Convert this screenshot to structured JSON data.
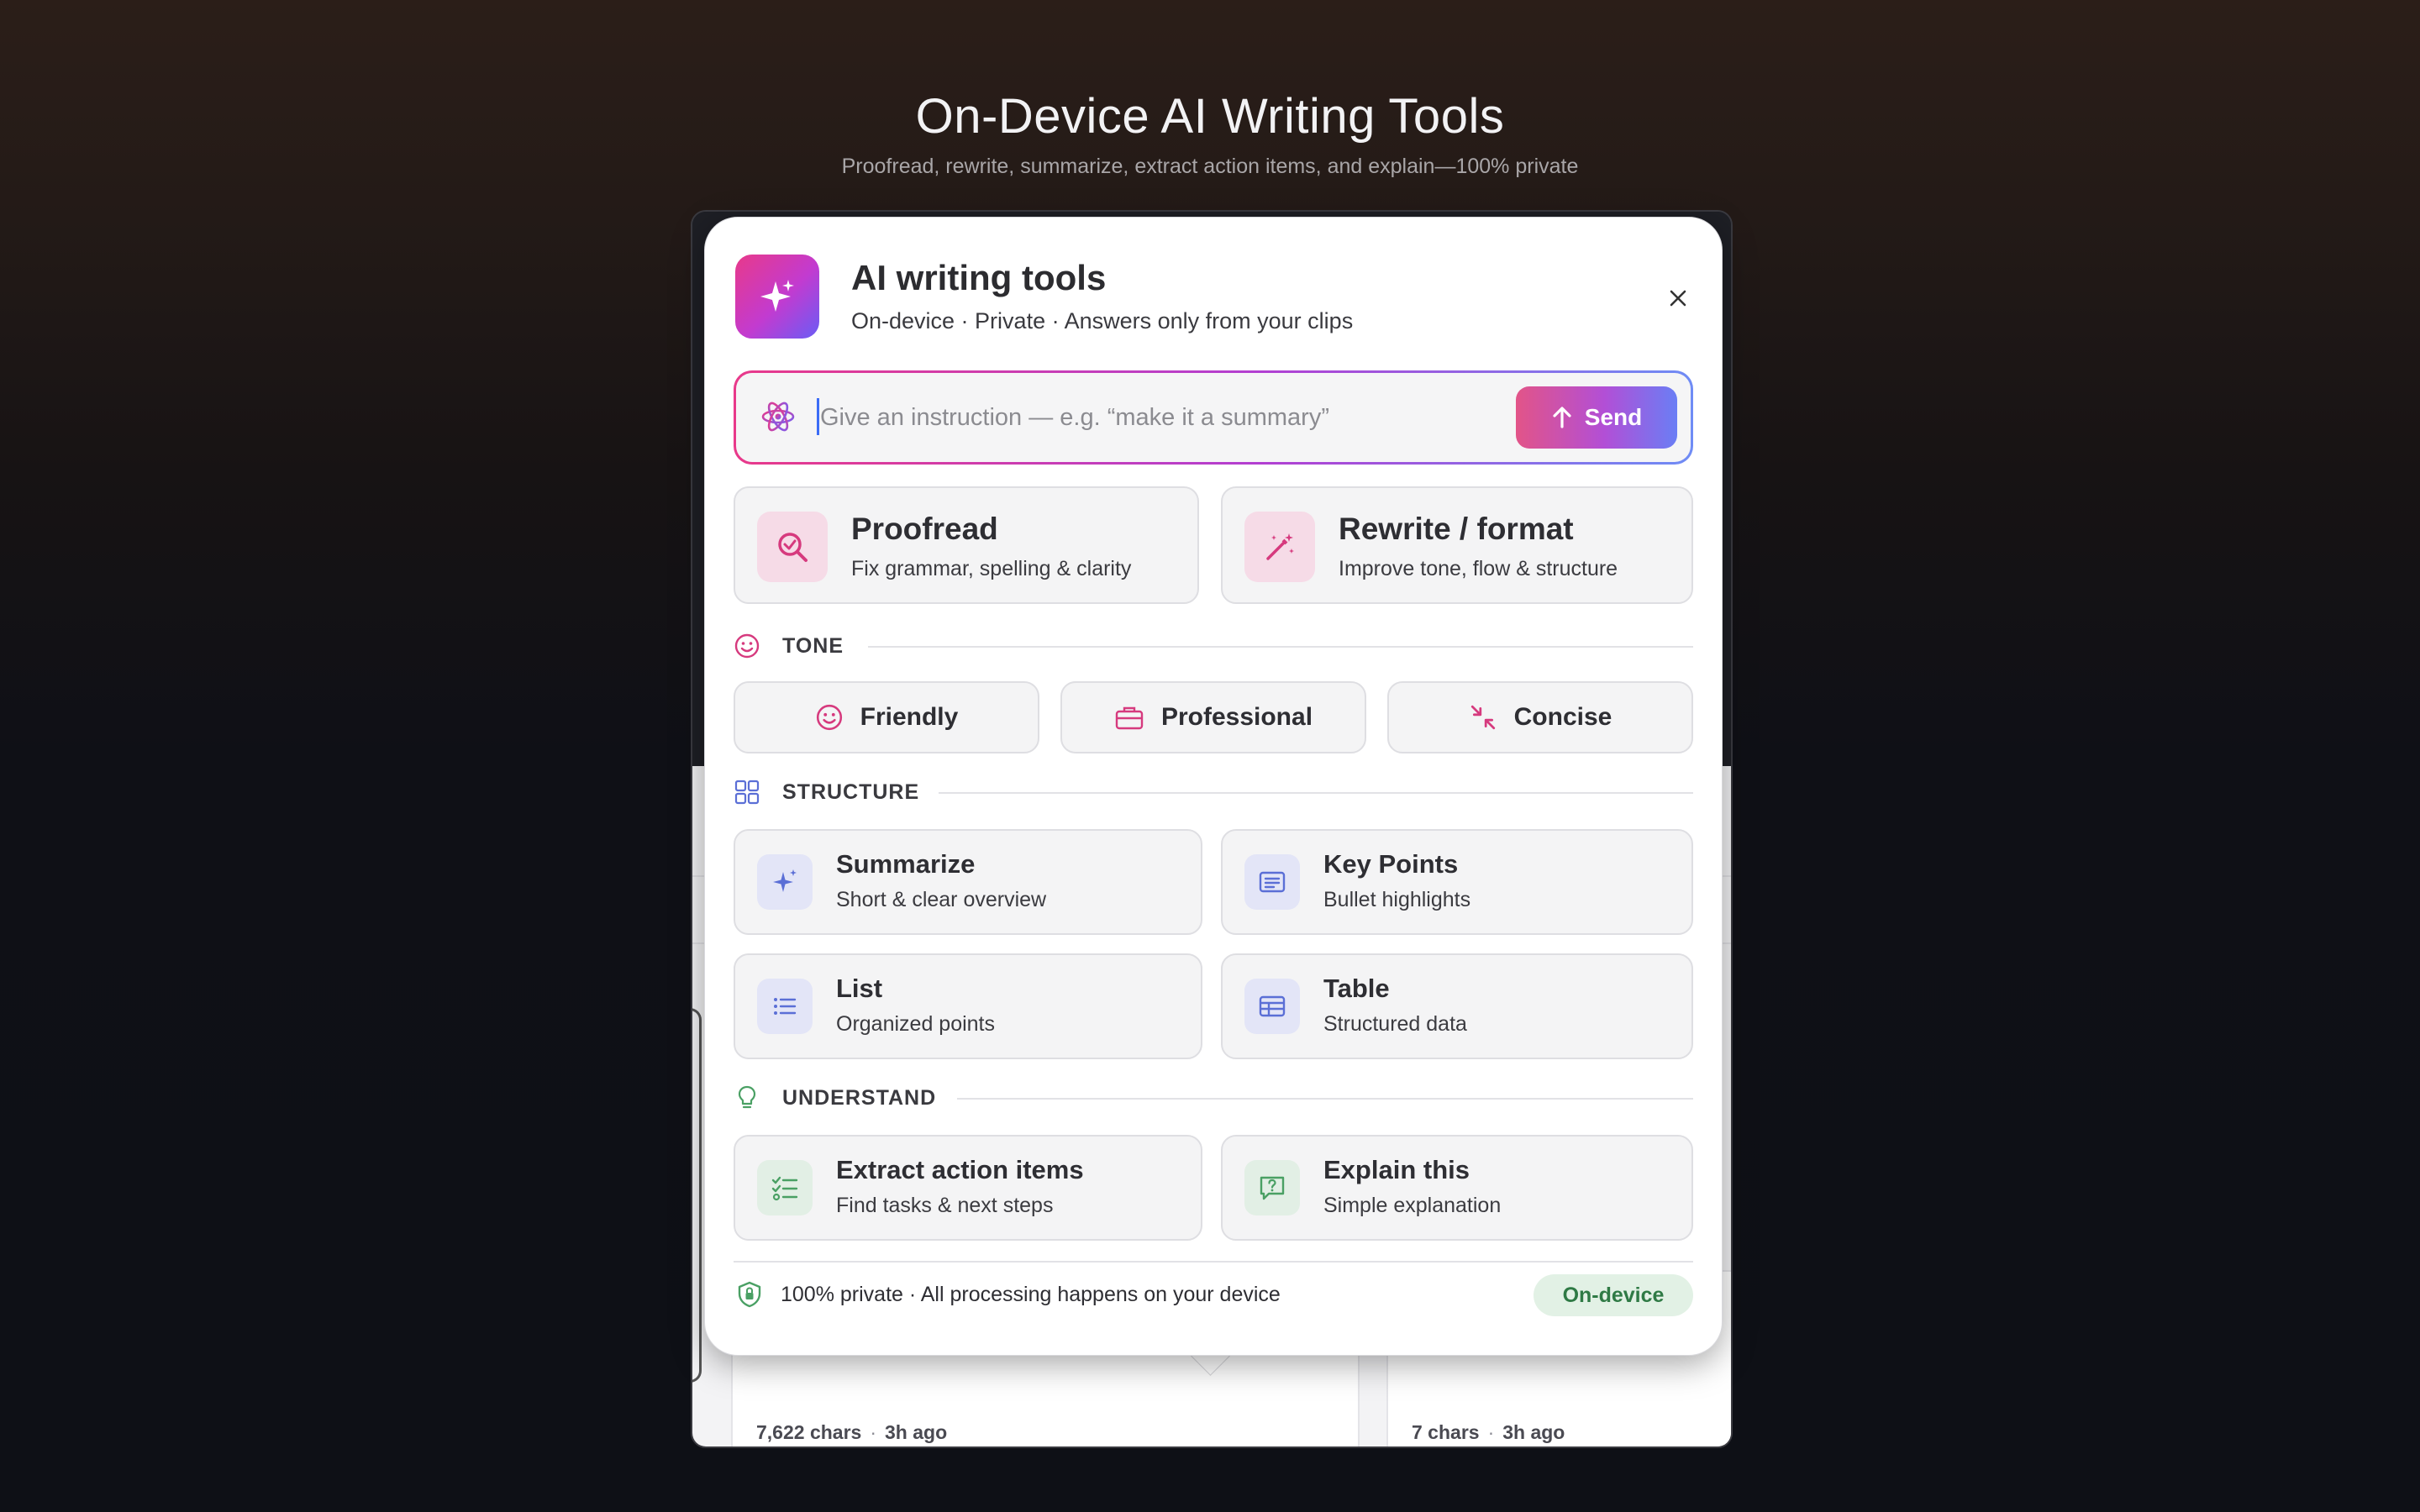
{
  "page": {
    "title": "On-Device AI Writing Tools",
    "subtitle": "Proofread, rewrite, summarize, extract action items, and explain—100% private"
  },
  "background_app": {
    "cards": [
      {
        "chars": "7,622 chars",
        "separator": "·",
        "time": "3h ago"
      },
      {
        "chars": "7 chars",
        "separator": "·",
        "time": "3h ago"
      }
    ]
  },
  "popup": {
    "title": "AI writing tools",
    "subtitle": "On-device · Private · Answers only from your clips",
    "instruction": {
      "placeholder": "Give an instruction — e.g. “make it a summary”",
      "value": "",
      "send_label": "Send"
    },
    "primary_actions": [
      {
        "title": "Proofread",
        "subtitle": "Fix grammar, spelling & clarity",
        "icon": "magnifier-check-icon"
      },
      {
        "title": "Rewrite / format",
        "subtitle": "Improve tone, flow & structure",
        "icon": "magic-wand-icon"
      }
    ],
    "tone": {
      "label": "TONE",
      "buttons": [
        {
          "label": "Friendly",
          "icon": "smiley-icon"
        },
        {
          "label": "Professional",
          "icon": "briefcase-icon"
        },
        {
          "label": "Concise",
          "icon": "minimize-arrows-icon"
        }
      ]
    },
    "structure": {
      "label": "STRUCTURE",
      "items": [
        {
          "title": "Summarize",
          "subtitle": "Short & clear overview",
          "icon": "sparkle-icon"
        },
        {
          "title": "Key Points",
          "subtitle": "Bullet highlights",
          "icon": "document-lines-icon"
        },
        {
          "title": "List",
          "subtitle": "Organized points",
          "icon": "bullet-list-icon"
        },
        {
          "title": "Table",
          "subtitle": "Structured data",
          "icon": "table-icon"
        }
      ]
    },
    "understand": {
      "label": "UNDERSTAND",
      "items": [
        {
          "title": "Extract action items",
          "subtitle": "Find tasks & next steps",
          "icon": "checklist-icon"
        },
        {
          "title": "Explain this",
          "subtitle": "Simple explanation",
          "icon": "question-bubble-icon"
        }
      ]
    },
    "footer": {
      "text": "100% private · All processing happens on your device",
      "badge": "On-device"
    }
  },
  "colors": {
    "accent_pink": "#e8398a",
    "accent_purple": "#b23fd2",
    "accent_blue": "#6f8cf5",
    "structure_blue": "#5b6fd6",
    "understand_green": "#4aa064",
    "badge_bg": "#e2f1e5",
    "badge_text": "#2f7a45"
  }
}
